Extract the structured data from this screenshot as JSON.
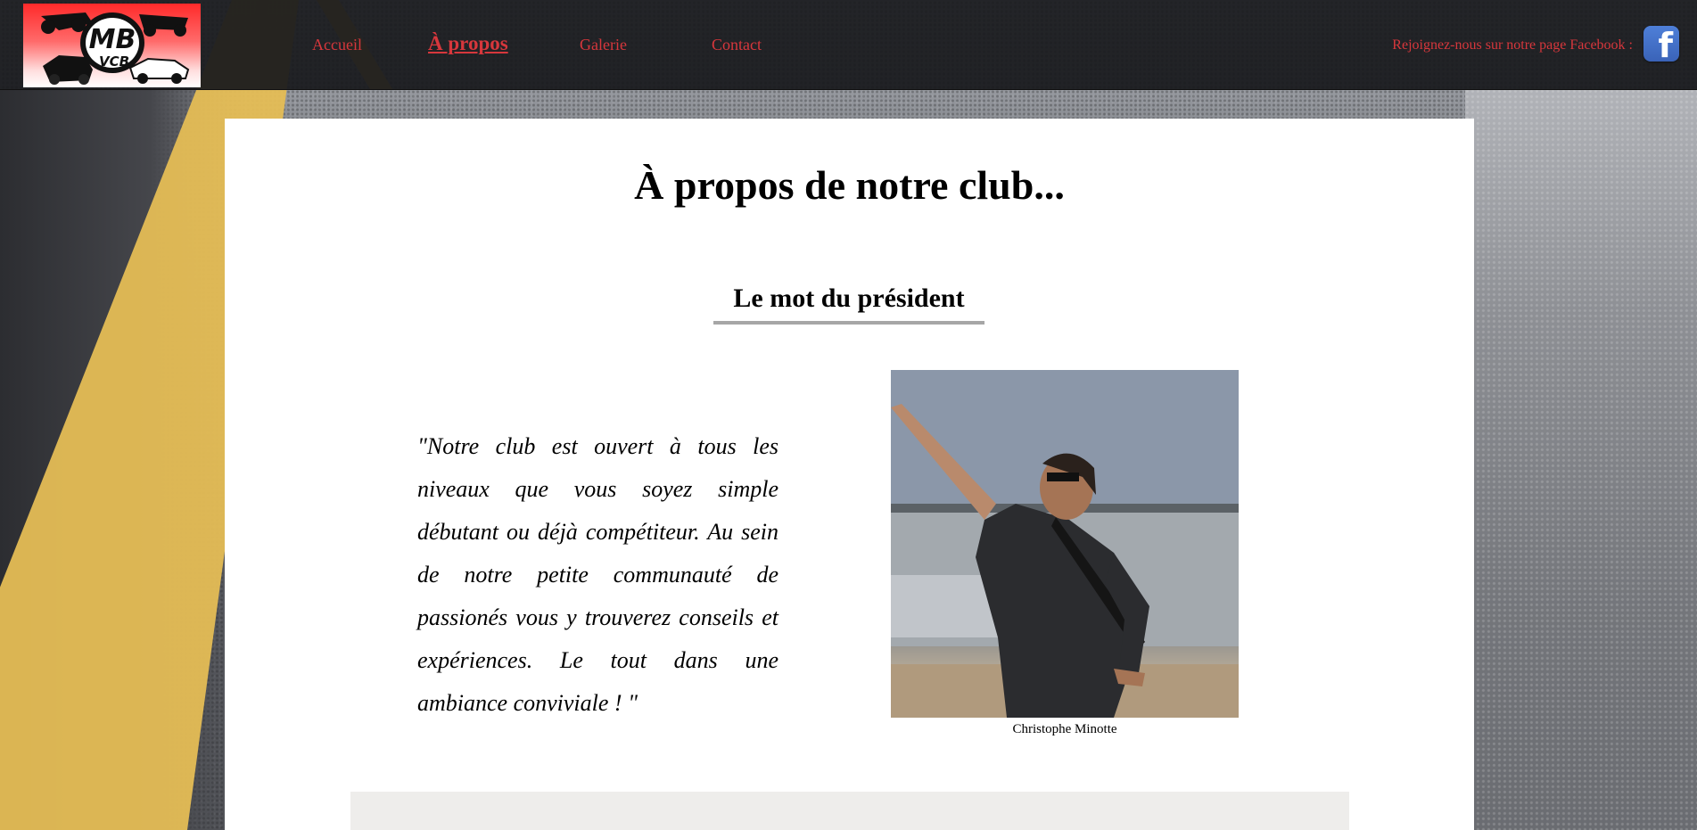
{
  "header": {
    "logo_alt": "MB VCB",
    "logo_line1": "MB",
    "logo_line2": "VCB",
    "nav": [
      {
        "label": "Accueil",
        "active": false
      },
      {
        "label": "À propos",
        "active": true
      },
      {
        "label": "Galerie",
        "active": false
      },
      {
        "label": "Contact",
        "active": false
      }
    ],
    "facebook_text": "Rejoignez-nous sur notre page Facebook :",
    "facebook_icon": "facebook-icon"
  },
  "main": {
    "title": "À propos de notre club...",
    "section_heading": "Le mot du président",
    "quote": "\"Notre club est ouvert à tous les niveaux que vous soyez simple débutant ou déjà compétiteur. Au sein de notre petite communauté de passionés vous y trouverez conseils et expériences. Le tout dans une ambiance conviviale ! \"",
    "photo_caption": "Christophe Minotte"
  },
  "colors": {
    "nav_link": "#d7373c",
    "header_bg": "#18191c",
    "panel_bg": "#ffffff",
    "heading_underline": "#a6a6a6"
  }
}
